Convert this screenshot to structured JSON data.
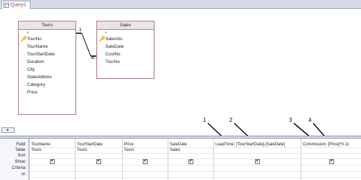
{
  "tab": {
    "title": "Query1"
  },
  "tables": [
    {
      "name": "Tours",
      "star": "*",
      "fields": [
        "TourNo",
        "TourName",
        "TourStartDate",
        "Duration",
        "City",
        "StateAbbrev",
        "Category",
        "Price"
      ],
      "primary_key": "TourNo"
    },
    {
      "name": "Sales",
      "star": "*",
      "fields": [
        "SalesNo",
        "SaleDate",
        "CustNo",
        "TourNo"
      ],
      "primary_key": "SalesNo"
    }
  ],
  "relationship": {
    "one_label": "1",
    "many_label": "∞"
  },
  "scroll": {
    "left_arrow": "◂"
  },
  "grid": {
    "row_labels": [
      "Field:",
      "Table:",
      "Sort:",
      "Show:",
      "Criteria:",
      "or:"
    ],
    "columns": [
      {
        "field": "TourName",
        "table": "Tours",
        "show": true
      },
      {
        "field": "TourStartDate",
        "table": "Tours",
        "show": true
      },
      {
        "field": "Price",
        "table": "Tours",
        "show": true
      },
      {
        "field": "SaleDate",
        "table": "Sales",
        "show": true
      },
      {
        "field": "LeadTime: [TourStartDate]-[SaleDate]",
        "table": "",
        "show": true
      },
      {
        "field": "Commission: [Price]*0.11",
        "table": "",
        "show": true
      }
    ]
  },
  "callouts": [
    "1",
    "2",
    "3",
    "4"
  ]
}
